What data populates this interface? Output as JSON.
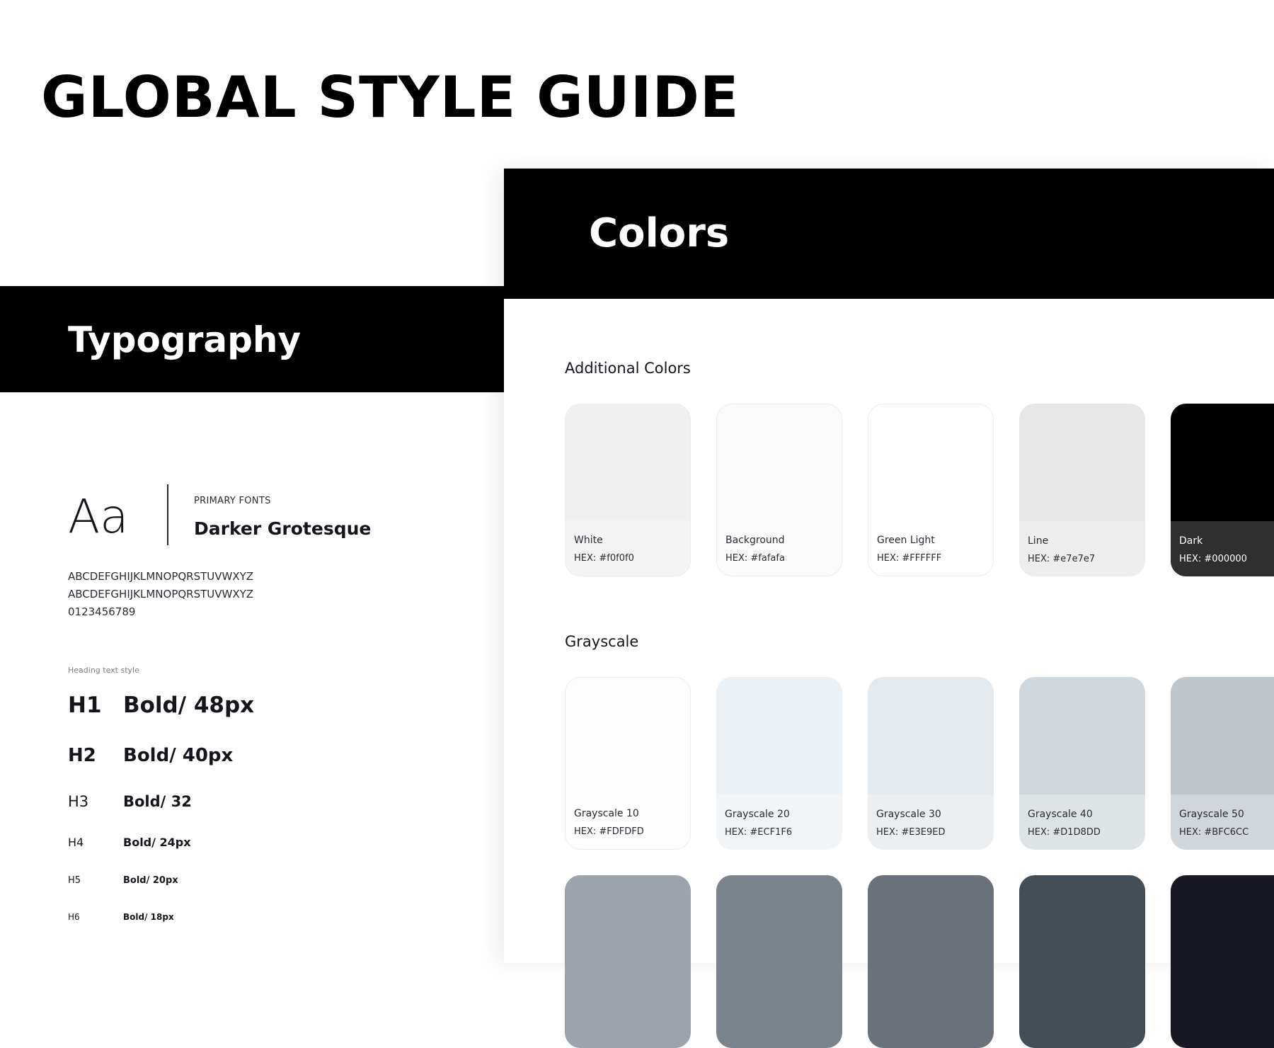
{
  "page": {
    "title": "GLOBAL STYLE GUIDE"
  },
  "typography": {
    "title": "Typography",
    "sample": "Aa",
    "font_caption": "PRIMARY FONTS",
    "font_name": "Darker Grotesque",
    "alphabet": [
      "ABCDEFGHIJKLMNOPQRSTUVWXYZ",
      "ABCDEFGHIJKLMNOPQRSTUVWXYZ",
      "0123456789"
    ],
    "heading_caption": "Heading text style",
    "headings": [
      {
        "tag": "H1",
        "spec": "Bold/ 48px"
      },
      {
        "tag": "H2",
        "spec": "Bold/ 40px"
      },
      {
        "tag": "H3",
        "spec": "Bold/ 32"
      },
      {
        "tag": "H4",
        "spec": "Bold/ 24px"
      },
      {
        "tag": "H5",
        "spec": "Bold/ 20px"
      },
      {
        "tag": "H6",
        "spec": "Bold/ 18px"
      }
    ]
  },
  "colors": {
    "title": "Colors",
    "additional": {
      "title": "Additional Colors",
      "swatches": [
        {
          "name": "White",
          "hex": "HEX: #f0f0f0",
          "color": "#f0f0f0"
        },
        {
          "name": "Background",
          "hex": "HEX: #fafafa",
          "color": "#fafafa"
        },
        {
          "name": "Green Light",
          "hex": "HEX: #FFFFFF",
          "color": "#ffffff"
        },
        {
          "name": "Line",
          "hex": "HEX: #e7e7e7",
          "color": "#e7e7e7"
        },
        {
          "name": "Dark",
          "hex": "HEX: #000000",
          "color": "#000000"
        }
      ]
    },
    "grayscale": {
      "title": "Grayscale",
      "swatches": [
        {
          "name": "Grayscale 10",
          "hex": "HEX: #FDFDFD",
          "color": "#fdfdfd"
        },
        {
          "name": "Grayscale 20",
          "hex": "HEX: #ECF1F6",
          "color": "#ecf1f6"
        },
        {
          "name": "Grayscale 30",
          "hex": "HEX: #E3E9ED",
          "color": "#e3e9ed"
        },
        {
          "name": "Grayscale 40",
          "hex": "HEX: #D1D8DD",
          "color": "#d1d8dd"
        },
        {
          "name": "Grayscale 50",
          "hex": "HEX: #BFC6CC",
          "color": "#bfc6cc"
        }
      ],
      "more": [
        {
          "color": "#9ca3aa"
        },
        {
          "color": "#7a838b"
        },
        {
          "color": "#6a717b"
        },
        {
          "color": "#434e57"
        },
        {
          "color": "#181822"
        }
      ]
    }
  }
}
